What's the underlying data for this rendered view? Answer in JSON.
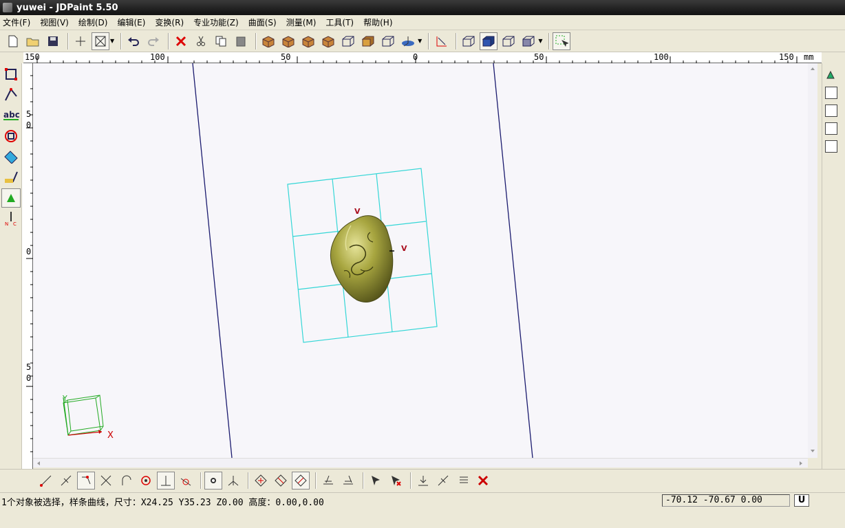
{
  "window": {
    "title": "yuwei - JDPaint 5.50"
  },
  "menu": [
    {
      "label": "文件(F)"
    },
    {
      "label": "视图(V)"
    },
    {
      "label": "绘制(D)"
    },
    {
      "label": "编辑(E)"
    },
    {
      "label": "变换(R)"
    },
    {
      "label": "专业功能(Z)"
    },
    {
      "label": "曲面(S)"
    },
    {
      "label": "测量(M)"
    },
    {
      "label": "工具(T)"
    },
    {
      "label": "帮助(H)"
    }
  ],
  "toolbar_icons": [
    "new-file-icon",
    "open-folder-icon",
    "save-icon",
    "crosshair-icon",
    "select-box-icon",
    "undo-icon",
    "redo-icon",
    "delete-icon",
    "cut-icon",
    "copy-icon",
    "paste-icon",
    "view-top-icon",
    "view-front-icon",
    "view-side-icon",
    "view-iso-icon",
    "wire-box-icon",
    "shade-box-icon",
    "shade-box-2-icon",
    "axis-view-icon",
    "coordinate-icon",
    "wireframe-icon",
    "solid-icon",
    "hidden-line-icon",
    "render-icon",
    "select-mode-icon"
  ],
  "ruler": {
    "unit": "mm",
    "top_labels": [
      "150",
      "100",
      "50",
      "0",
      "50",
      "100",
      "150"
    ],
    "left_labels": [
      "5\n0",
      "0",
      "5\n0"
    ]
  },
  "viewport": {
    "axis_x": "X",
    "axis_y": "Y",
    "marker_label_1": "V",
    "marker_label_2": "V",
    "colors": {
      "background": "#f7f6fa",
      "grid": "#33d6d6",
      "guide_lines": "#1a1a6e",
      "model": "#9a9a3a",
      "axis": "#22aa22",
      "xaxis": "#cc0000"
    }
  },
  "status": {
    "message": "1个对象被选择，样条曲线，尺寸：X24.25 Y35.23 Z0.00 高度：0.00,0.00",
    "coordinates": "-70.12 -70.67 0.00",
    "unit_button": "U"
  }
}
